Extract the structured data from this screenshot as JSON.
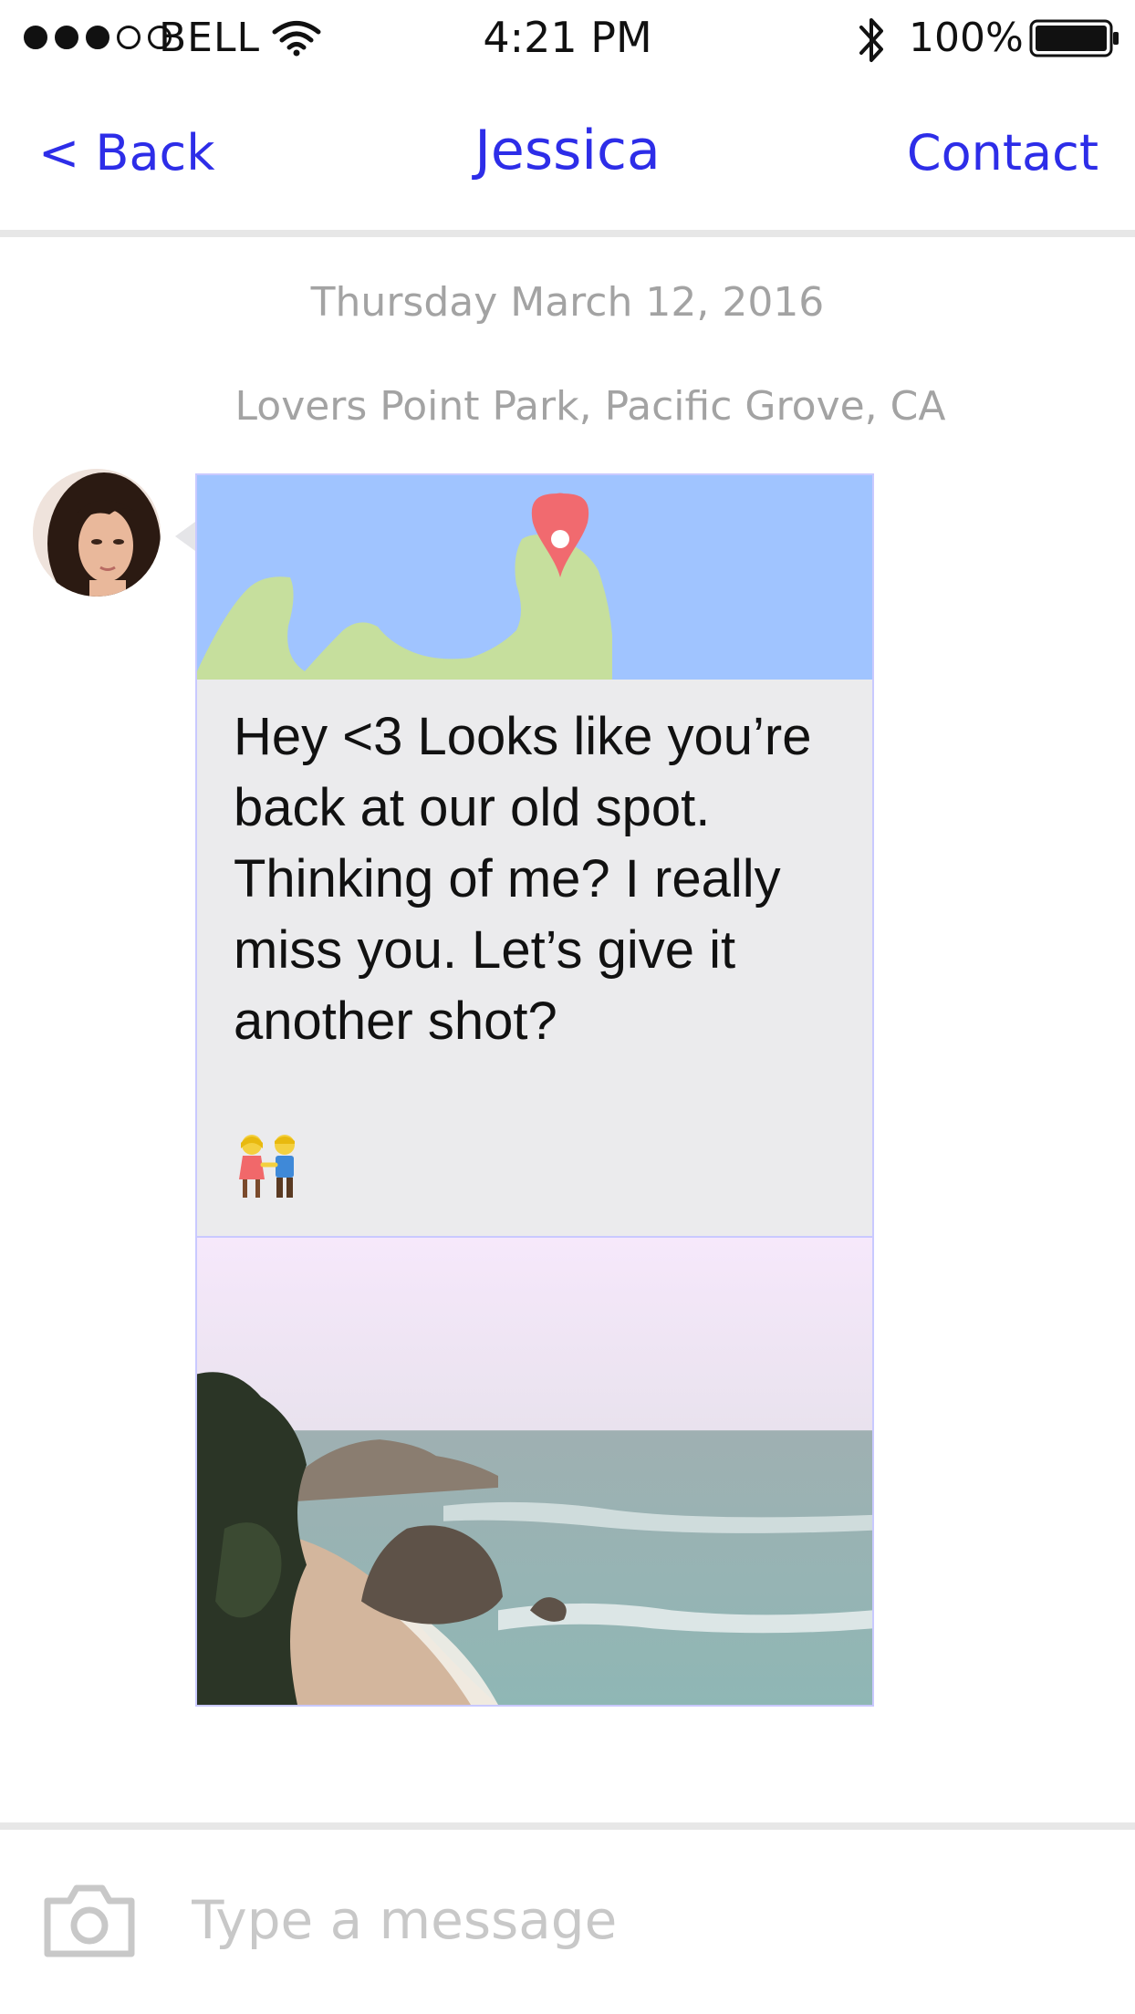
{
  "status_bar": {
    "carrier": "BELL",
    "time": "4:21 PM",
    "battery_percent": "100%",
    "signal_strength": 3,
    "signal_max": 5,
    "battery_level": 1.0
  },
  "nav": {
    "back_label": "< Back",
    "title": "Jessica",
    "contact_label": "Contact"
  },
  "thread": {
    "date": "Thursday March 12, 2016",
    "location": "Lovers Point Park, Pacific Grove, CA"
  },
  "message": {
    "text": "Hey <3 Looks like you’re back at our old spot. Thinking of me? I really miss you. Let’s give it another shot?",
    "emoji_icon": "couple-holding-hands-icon"
  },
  "compose": {
    "placeholder": "Type a message"
  },
  "colors": {
    "accent": "#2d2de8",
    "secondary_text": "#a3a3a3",
    "bubble": "#ebebed",
    "map_water": "#a0c4ff",
    "map_land": "#c6df9d",
    "map_pin": "#f16a6f"
  }
}
